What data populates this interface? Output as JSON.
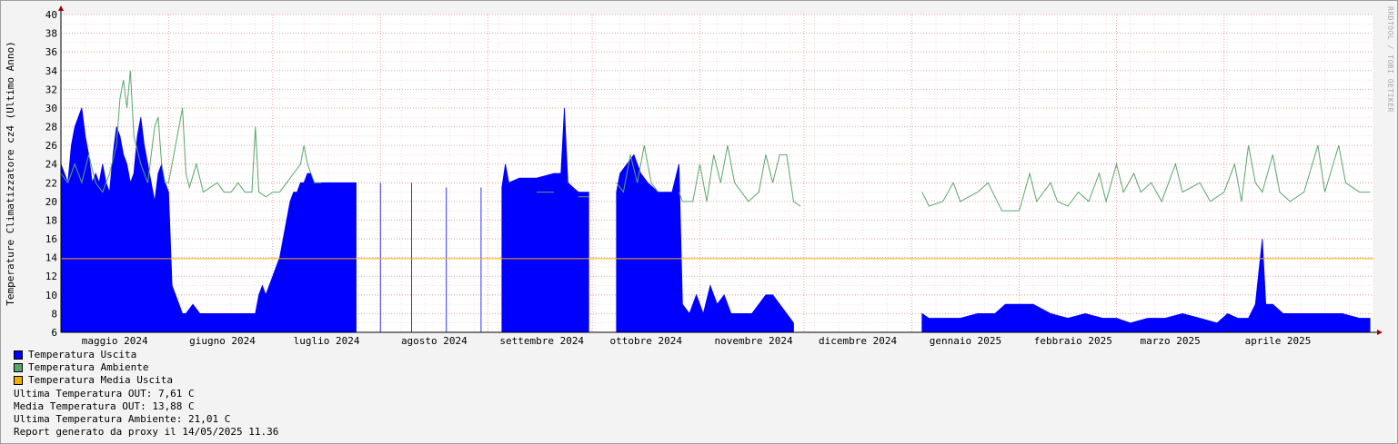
{
  "chart_data": {
    "type": "area",
    "ylabel": "Temperature Climatizzatore cz4 (Ultimo Anno)",
    "ylim": [
      6,
      40
    ],
    "yticks": [
      6,
      8,
      10,
      12,
      14,
      16,
      18,
      20,
      22,
      24,
      26,
      28,
      30,
      32,
      34,
      36,
      38,
      40
    ],
    "xlim": [
      "2024-05-01",
      "2025-05-14"
    ],
    "month_labels": [
      {
        "label": "maggio 2024",
        "date": "2024-05-01"
      },
      {
        "label": "giugno 2024",
        "date": "2024-06-01"
      },
      {
        "label": "luglio 2024",
        "date": "2024-07-01"
      },
      {
        "label": "agosto 2024",
        "date": "2024-08-01"
      },
      {
        "label": "settembre 2024",
        "date": "2024-09-01"
      },
      {
        "label": "ottobre 2024",
        "date": "2024-10-01"
      },
      {
        "label": "novembre 2024",
        "date": "2024-11-01"
      },
      {
        "label": "dicembre 2024",
        "date": "2024-12-01"
      },
      {
        "label": "gennaio 2025",
        "date": "2025-01-01"
      },
      {
        "label": "febbraio 2025",
        "date": "2025-02-01"
      },
      {
        "label": "marzo 2025",
        "date": "2025-03-01"
      },
      {
        "label": "aprile 2025",
        "date": "2025-04-01"
      }
    ],
    "grid": true,
    "series": [
      {
        "name": "Temperatura Uscita",
        "color": "#0000ff",
        "style": "area",
        "points": [
          [
            "2024-05-01",
            24
          ],
          [
            "2024-05-02",
            23
          ],
          [
            "2024-05-03",
            22
          ],
          [
            "2024-05-04",
            26
          ],
          [
            "2024-05-05",
            28
          ],
          [
            "2024-05-06",
            29
          ],
          [
            "2024-05-07",
            30
          ],
          [
            "2024-05-08",
            27
          ],
          [
            "2024-05-09",
            25
          ],
          [
            "2024-05-10",
            22
          ],
          [
            "2024-05-11",
            23
          ],
          [
            "2024-05-12",
            22
          ],
          [
            "2024-05-13",
            24
          ],
          [
            "2024-05-14",
            22
          ],
          [
            "2024-05-15",
            21
          ],
          [
            "2024-05-16",
            25
          ],
          [
            "2024-05-17",
            28
          ],
          [
            "2024-05-18",
            27
          ],
          [
            "2024-05-19",
            25
          ],
          [
            "2024-05-20",
            24
          ],
          [
            "2024-05-21",
            22
          ],
          [
            "2024-05-22",
            23
          ],
          [
            "2024-05-23",
            27
          ],
          [
            "2024-05-24",
            29
          ],
          [
            "2024-05-25",
            26
          ],
          [
            "2024-05-26",
            24
          ],
          [
            "2024-05-27",
            22
          ],
          [
            "2024-05-28",
            20
          ],
          [
            "2024-05-29",
            23
          ],
          [
            "2024-05-30",
            24
          ],
          [
            "2024-05-31",
            22
          ],
          [
            "2024-06-01",
            21
          ],
          [
            "2024-06-02",
            11
          ],
          [
            "2024-06-03",
            10
          ],
          [
            "2024-06-04",
            9
          ],
          [
            "2024-06-05",
            8
          ],
          [
            "2024-06-06",
            8
          ],
          [
            "2024-06-08",
            9
          ],
          [
            "2024-06-10",
            8
          ],
          [
            "2024-06-12",
            8
          ],
          [
            "2024-06-14",
            8
          ],
          [
            "2024-06-16",
            8
          ],
          [
            "2024-06-18",
            8
          ],
          [
            "2024-06-20",
            8
          ],
          [
            "2024-06-22",
            8
          ],
          [
            "2024-06-24",
            8
          ],
          [
            "2024-06-26",
            8
          ],
          [
            "2024-06-27",
            10
          ],
          [
            "2024-06-28",
            11
          ],
          [
            "2024-06-29",
            10
          ],
          [
            "2024-07-01",
            12
          ],
          [
            "2024-07-02",
            13
          ],
          [
            "2024-07-03",
            14
          ],
          [
            "2024-07-04",
            16
          ],
          [
            "2024-07-05",
            18
          ],
          [
            "2024-07-06",
            20
          ],
          [
            "2024-07-07",
            21
          ],
          [
            "2024-07-08",
            21
          ],
          [
            "2024-07-09",
            22
          ],
          [
            "2024-07-10",
            22
          ],
          [
            "2024-07-11",
            23
          ],
          [
            "2024-07-12",
            23
          ],
          [
            "2024-07-13",
            22
          ],
          [
            "2024-07-15",
            22
          ],
          [
            "2024-07-20",
            22
          ],
          [
            "2024-07-25",
            22
          ],
          [
            "2024-08-01",
            22
          ],
          [
            "2024-08-10",
            22
          ],
          [
            "2024-08-20",
            21.5
          ],
          [
            "2024-08-30",
            21.5
          ],
          [
            "2024-09-05",
            21.5
          ],
          [
            "2024-09-06",
            24
          ],
          [
            "2024-09-07",
            22
          ],
          [
            "2024-09-10",
            22.5
          ],
          [
            "2024-09-15",
            22.5
          ],
          [
            "2024-09-20",
            23
          ],
          [
            "2024-09-22",
            23
          ],
          [
            "2024-09-23",
            30
          ],
          [
            "2024-09-24",
            22
          ],
          [
            "2024-09-27",
            21
          ],
          [
            "2024-09-30",
            21
          ],
          [
            "2024-10-08",
            21
          ],
          [
            "2024-10-09",
            23
          ],
          [
            "2024-10-11",
            24
          ],
          [
            "2024-10-13",
            25
          ],
          [
            "2024-10-15",
            23
          ],
          [
            "2024-10-17",
            22
          ],
          [
            "2024-10-20",
            21
          ],
          [
            "2024-10-24",
            21
          ],
          [
            "2024-10-26",
            24
          ],
          [
            "2024-10-27",
            9
          ],
          [
            "2024-10-29",
            8
          ],
          [
            "2024-10-31",
            10
          ],
          [
            "2024-11-02",
            8
          ],
          [
            "2024-11-04",
            11
          ],
          [
            "2024-11-06",
            9
          ],
          [
            "2024-11-08",
            10
          ],
          [
            "2024-11-10",
            8
          ],
          [
            "2024-11-12",
            8
          ],
          [
            "2024-11-14",
            8
          ],
          [
            "2024-11-16",
            8
          ],
          [
            "2024-11-18",
            9
          ],
          [
            "2024-11-20",
            10
          ],
          [
            "2024-11-22",
            10
          ],
          [
            "2024-11-24",
            9
          ],
          [
            "2024-11-26",
            8
          ],
          [
            "2024-11-28",
            7
          ],
          [
            "2025-01-04",
            8
          ],
          [
            "2025-01-06",
            7.5
          ],
          [
            "2025-01-10",
            7.5
          ],
          [
            "2025-01-15",
            7.5
          ],
          [
            "2025-01-20",
            8
          ],
          [
            "2025-01-25",
            8
          ],
          [
            "2025-01-28",
            9
          ],
          [
            "2025-02-01",
            9
          ],
          [
            "2025-02-05",
            9
          ],
          [
            "2025-02-10",
            8
          ],
          [
            "2025-02-15",
            7.5
          ],
          [
            "2025-02-20",
            8
          ],
          [
            "2025-02-25",
            7.5
          ],
          [
            "2025-03-01",
            7.5
          ],
          [
            "2025-03-05",
            7
          ],
          [
            "2025-03-10",
            7.5
          ],
          [
            "2025-03-15",
            7.5
          ],
          [
            "2025-03-20",
            8
          ],
          [
            "2025-03-25",
            7.5
          ],
          [
            "2025-03-30",
            7
          ],
          [
            "2025-04-02",
            8
          ],
          [
            "2025-04-05",
            7.5
          ],
          [
            "2025-04-08",
            7.5
          ],
          [
            "2025-04-10",
            9
          ],
          [
            "2025-04-12",
            16
          ],
          [
            "2025-04-13",
            9
          ],
          [
            "2025-04-15",
            9
          ],
          [
            "2025-04-18",
            8
          ],
          [
            "2025-04-22",
            8
          ],
          [
            "2025-04-26",
            8
          ],
          [
            "2025-04-30",
            8
          ],
          [
            "2025-05-05",
            8
          ],
          [
            "2025-05-10",
            7.5
          ],
          [
            "2025-05-13",
            7.5
          ]
        ]
      },
      {
        "name": "Temperatura Ambiente",
        "color": "#5aa66a",
        "style": "line",
        "points": [
          [
            "2024-05-01",
            23
          ],
          [
            "2024-05-03",
            22
          ],
          [
            "2024-05-05",
            24
          ],
          [
            "2024-05-07",
            22
          ],
          [
            "2024-05-09",
            25
          ],
          [
            "2024-05-11",
            22
          ],
          [
            "2024-05-13",
            21
          ],
          [
            "2024-05-15",
            23
          ],
          [
            "2024-05-17",
            26
          ],
          [
            "2024-05-18",
            31
          ],
          [
            "2024-05-19",
            33
          ],
          [
            "2024-05-20",
            30
          ],
          [
            "2024-05-21",
            34
          ],
          [
            "2024-05-22",
            27
          ],
          [
            "2024-05-24",
            24
          ],
          [
            "2024-05-26",
            22
          ],
          [
            "2024-05-28",
            28
          ],
          [
            "2024-05-29",
            29
          ],
          [
            "2024-05-30",
            24
          ],
          [
            "2024-05-31",
            22
          ],
          [
            "2024-06-01",
            22
          ],
          [
            "2024-06-03",
            26
          ],
          [
            "2024-06-05",
            30
          ],
          [
            "2024-06-06",
            23
          ],
          [
            "2024-06-07",
            21.5
          ],
          [
            "2024-06-09",
            24
          ],
          [
            "2024-06-11",
            21
          ],
          [
            "2024-06-13",
            21.5
          ],
          [
            "2024-06-15",
            22
          ],
          [
            "2024-06-17",
            21
          ],
          [
            "2024-06-19",
            21
          ],
          [
            "2024-06-21",
            22
          ],
          [
            "2024-06-23",
            21
          ],
          [
            "2024-06-25",
            21
          ],
          [
            "2024-06-26",
            28
          ],
          [
            "2024-06-27",
            21
          ],
          [
            "2024-06-29",
            20.5
          ],
          [
            "2024-07-01",
            21
          ],
          [
            "2024-07-03",
            21
          ],
          [
            "2024-07-05",
            22
          ],
          [
            "2024-07-07",
            23
          ],
          [
            "2024-07-09",
            24
          ],
          [
            "2024-07-10",
            26
          ],
          [
            "2024-07-11",
            24
          ],
          [
            "2024-07-13",
            22
          ],
          [
            "2024-07-15",
            22
          ],
          [
            "2024-07-31",
            22
          ],
          [
            "2024-08-10",
            21.5
          ],
          [
            "2024-08-20",
            21
          ],
          [
            "2024-08-30",
            21
          ],
          [
            "2024-09-05",
            21
          ],
          [
            "2024-09-15",
            21
          ],
          [
            "2024-09-20",
            21
          ],
          [
            "2024-09-27",
            20.5
          ],
          [
            "2024-09-30",
            20.5
          ],
          [
            "2024-10-08",
            22
          ],
          [
            "2024-10-10",
            21
          ],
          [
            "2024-10-12",
            25
          ],
          [
            "2024-10-14",
            22
          ],
          [
            "2024-10-16",
            26
          ],
          [
            "2024-10-18",
            22
          ],
          [
            "2024-10-20",
            21
          ],
          [
            "2024-10-26",
            21
          ],
          [
            "2024-10-27",
            20
          ],
          [
            "2024-10-30",
            20
          ],
          [
            "2024-11-01",
            24
          ],
          [
            "2024-11-03",
            20
          ],
          [
            "2024-11-05",
            25
          ],
          [
            "2024-11-07",
            22
          ],
          [
            "2024-11-09",
            26
          ],
          [
            "2024-11-11",
            22
          ],
          [
            "2024-11-13",
            21
          ],
          [
            "2024-11-15",
            20
          ],
          [
            "2024-11-18",
            21
          ],
          [
            "2024-11-20",
            25
          ],
          [
            "2024-11-22",
            22
          ],
          [
            "2024-11-24",
            25
          ],
          [
            "2024-11-26",
            25
          ],
          [
            "2024-11-28",
            20
          ],
          [
            "2024-11-30",
            19.5
          ],
          [
            "2025-01-04",
            21
          ],
          [
            "2025-01-06",
            19.5
          ],
          [
            "2025-01-10",
            20
          ],
          [
            "2025-01-13",
            22
          ],
          [
            "2025-01-15",
            20
          ],
          [
            "2025-01-20",
            21
          ],
          [
            "2025-01-23",
            22
          ],
          [
            "2025-01-27",
            19
          ],
          [
            "2025-02-01",
            19
          ],
          [
            "2025-02-04",
            23
          ],
          [
            "2025-02-06",
            20
          ],
          [
            "2025-02-10",
            22
          ],
          [
            "2025-02-12",
            20
          ],
          [
            "2025-02-15",
            19.5
          ],
          [
            "2025-02-18",
            21
          ],
          [
            "2025-02-21",
            20
          ],
          [
            "2025-02-24",
            23
          ],
          [
            "2025-02-26",
            20
          ],
          [
            "2025-03-01",
            24
          ],
          [
            "2025-03-03",
            21
          ],
          [
            "2025-03-06",
            23
          ],
          [
            "2025-03-08",
            21
          ],
          [
            "2025-03-11",
            22
          ],
          [
            "2025-03-14",
            20
          ],
          [
            "2025-03-18",
            24
          ],
          [
            "2025-03-20",
            21
          ],
          [
            "2025-03-25",
            22
          ],
          [
            "2025-03-28",
            20
          ],
          [
            "2025-04-01",
            21
          ],
          [
            "2025-04-04",
            24
          ],
          [
            "2025-04-06",
            20
          ],
          [
            "2025-04-08",
            26
          ],
          [
            "2025-04-10",
            22
          ],
          [
            "2025-04-12",
            21
          ],
          [
            "2025-04-15",
            25
          ],
          [
            "2025-04-17",
            21
          ],
          [
            "2025-04-20",
            20
          ],
          [
            "2025-04-24",
            21
          ],
          [
            "2025-04-28",
            26
          ],
          [
            "2025-04-30",
            21
          ],
          [
            "2025-05-04",
            26
          ],
          [
            "2025-05-06",
            22
          ],
          [
            "2025-05-10",
            21
          ],
          [
            "2025-05-13",
            21
          ]
        ]
      },
      {
        "name": "Temperatura Media Uscita",
        "color": "#f0b000",
        "style": "hline",
        "value": 13.88
      }
    ]
  },
  "legend": {
    "uscita": "Temperatura Uscita",
    "ambiente": "Temperatura Ambiente",
    "media": "Temperatura Media Uscita",
    "colors": {
      "uscita": "#0000ff",
      "ambiente": "#5aa66a",
      "media": "#f0b000"
    }
  },
  "stats": {
    "ultima_out": "Ultima Temperatura OUT: 7,61 C",
    "media_out": "Media Temperatura OUT: 13,88 C",
    "ultima_ambiente": "Ultima Temperatura Ambiente: 21,01 C",
    "report": "Report generato da proxy il 14/05/2025 11.36"
  },
  "watermark": "RRDTOOL / TOBI OETIKER"
}
